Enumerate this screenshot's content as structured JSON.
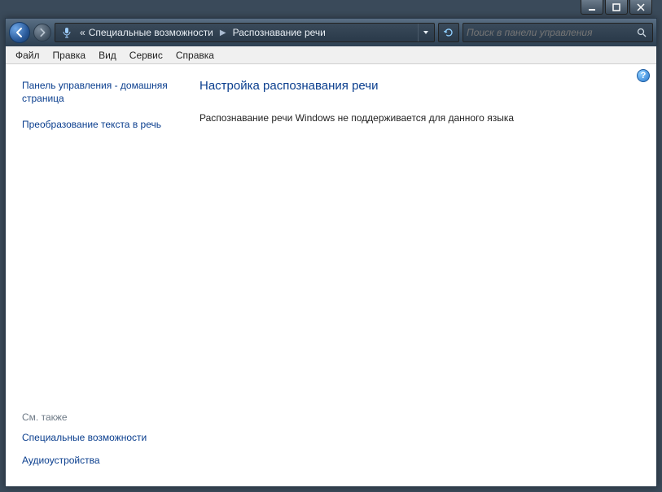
{
  "breadcrumb": {
    "prefix": "«",
    "parent": "Специальные возможности",
    "current": "Распознавание речи"
  },
  "search": {
    "placeholder": "Поиск в панели управления"
  },
  "menu": {
    "file": "Файл",
    "edit": "Правка",
    "view": "Вид",
    "service": "Сервис",
    "help": "Справка"
  },
  "sidebar": {
    "home": "Панель управления - домашняя страница",
    "tts": "Преобразование текста в речь",
    "seealso_header": "См. также",
    "seealso": {
      "ease": "Специальные возможности",
      "audio": "Аудиоустройства"
    }
  },
  "content": {
    "title": "Настройка распознавания речи",
    "message": "Распознавание речи Windows не поддерживается для данного языка"
  },
  "help_glyph": "?"
}
